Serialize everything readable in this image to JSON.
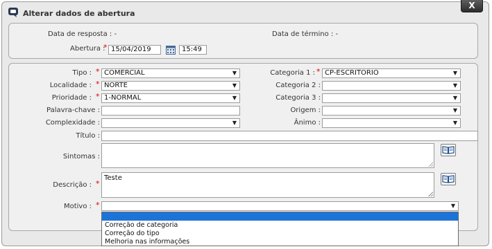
{
  "dialog": {
    "title": "Alterar dados de abertura",
    "close_label": "X"
  },
  "top": {
    "data_resposta_label": "Data de resposta :",
    "data_resposta_value": "-",
    "data_termino_label": "Data de término :",
    "data_termino_value": "-",
    "abertura_label": "Abertura :",
    "abertura_date": "15/04/2019",
    "abertura_time": "15:49"
  },
  "form": {
    "tipo_label": "Tipo :",
    "tipo_value": "COMERCIAL",
    "localidade_label": "Localidade :",
    "localidade_value": "NORTE",
    "prioridade_label": "Prioridade :",
    "prioridade_value": "1-NORMAL",
    "palavra_chave_label": "Palavra-chave :",
    "palavra_chave_value": "",
    "complexidade_label": "Complexidade :",
    "complexidade_value": "",
    "categoria1_label": "Categoria 1 :",
    "categoria1_value": "CP-ESCRITÓRIO",
    "categoria2_label": "Categoria 2 :",
    "categoria2_value": "",
    "categoria3_label": "Categoria 3 :",
    "categoria3_value": "",
    "origem_label": "Origem :",
    "origem_value": "",
    "animo_label": "Ânimo :",
    "animo_value": "",
    "titulo_label": "Título :",
    "titulo_value": "",
    "sintomas_label": "Sintomas :",
    "sintomas_value": "",
    "descricao_label": "Descrição :",
    "descricao_value": "Teste",
    "motivo_label": "Motivo :",
    "motivo_value": "",
    "required_mark": "*"
  },
  "motivo_options": [
    "Correção de categoria",
    "Correção do tipo",
    "Melhoria nas informações"
  ],
  "icons": {
    "title": "chat-bubble-icon",
    "calendar": "calendar-icon",
    "book": "book-icon"
  },
  "colors": {
    "highlight": "#1d74d8",
    "required": "#e00000"
  }
}
